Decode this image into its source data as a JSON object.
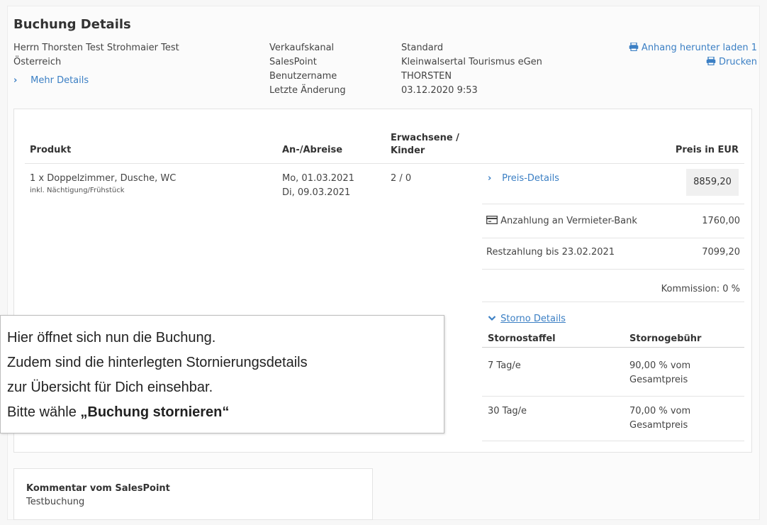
{
  "header": {
    "title": "Buchung Details",
    "customer_name": "Herrn Thorsten Test Strohmaier Test",
    "customer_country": "Österreich",
    "more_details": "Mehr Details"
  },
  "meta": {
    "labels": [
      "Verkaufskanal",
      "SalesPoint",
      "Benutzername",
      "Letzte Änderung"
    ],
    "values": [
      "Standard",
      "Kleinwalsertal Tourismus eGen",
      "THORSTEN",
      "03.12.2020 9:53"
    ]
  },
  "actions": {
    "download": "Anhang herunter laden 1",
    "print": "Drucken"
  },
  "table": {
    "headers": {
      "product": "Produkt",
      "dates": "An-/Abreise",
      "guests_line1": "Erwachsene /",
      "guests_line2": "Kinder",
      "price": "Preis in EUR"
    },
    "row": {
      "product": "1 x Doppelzimmer, Dusche, WC",
      "product_sub": "inkl. Nächtigung/Frühstück",
      "arrival": "Mo, 01.03.2021",
      "departure": "Di, 09.03.2021",
      "guests": "2 / 0",
      "price_details": "Preis-Details",
      "price": "8859,20"
    }
  },
  "payments": {
    "deposit_label": "Anzahlung an Vermieter-Bank",
    "deposit_value": "1760,00",
    "rest_label": "Restzahlung bis 23.02.2021",
    "rest_value": "7099,20",
    "commission": "Kommission: 0 %"
  },
  "storno": {
    "toggle": "Storno Details",
    "col1": "Stornostaffel",
    "col2": "Stornogebühr",
    "rows": [
      {
        "days": "7 Tag/e",
        "fee_l1": "90,00 % vom",
        "fee_l2": "Gesamtpreis"
      },
      {
        "days": "30 Tag/e",
        "fee_l1": "70,00 % vom",
        "fee_l2": "Gesamtpreis"
      }
    ]
  },
  "overlay": {
    "line1": "Hier öffnet sich nun die Buchung.",
    "line2": "Zudem sind die hinterlegten Stornierungsdetails",
    "line3": "zur Übersicht für Dich einsehbar.",
    "line4_prefix": "Bitte wähle ",
    "line4_bold": "„Buchung stornieren“"
  },
  "comment": {
    "title": "Kommentar vom SalesPoint",
    "text": "Testbuchung"
  },
  "colors": {
    "link": "#3b7fc4"
  }
}
